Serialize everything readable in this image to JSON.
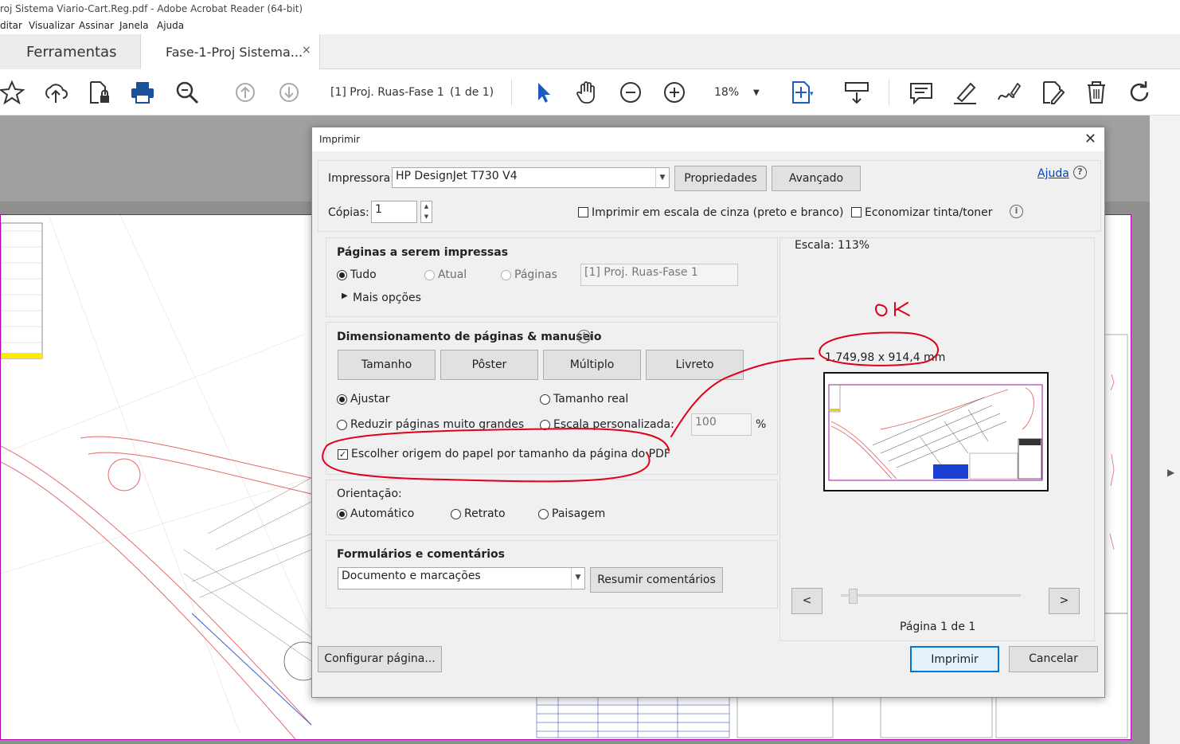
{
  "window": {
    "title": "roj Sistema Viario-Cart.Reg.pdf - Adobe Acrobat Reader (64-bit)"
  },
  "menu": [
    "ditar",
    "Visualizar",
    "Assinar",
    "Janela",
    "Ajuda"
  ],
  "tabs": {
    "tools": "Ferramentas",
    "document": "Fase-1-Proj Sistema...",
    "close": "×"
  },
  "toolbar": {
    "page_label": "[1] Proj. Ruas-Fase 1",
    "page_count": "(1 de 1)",
    "zoom": "18%",
    "icons": [
      "star-icon",
      "cloud-upload-icon",
      "file-lock-icon",
      "print-icon",
      "zoom-search-icon",
      "arrow-up-icon",
      "arrow-down-icon",
      "pointer-icon",
      "hand-icon",
      "zoom-out-icon",
      "zoom-in-icon",
      "fit-page-icon",
      "scroll-mode-icon",
      "comment-icon",
      "highlight-icon",
      "sign-icon",
      "edit-icon",
      "delete-icon",
      "rotate-icon"
    ]
  },
  "dialog": {
    "title": "Imprimir",
    "close": "✕",
    "printer_label": "Impressora:",
    "printer_value": "HP DesignJet T730 V4",
    "properties_button": "Propriedades",
    "advanced_button": "Avançado",
    "help_link": "Ajuda",
    "help_glyph": "?",
    "copies_label": "Cópias:",
    "copies_value": "1",
    "grayscale_label": "Imprimir em escala de cinza (preto e branco)",
    "save_ink_label": "Economizar tinta/toner",
    "info_glyph": "i",
    "pages_group": {
      "title": "Páginas a serem impressas",
      "all": "Tudo",
      "current": "Atual",
      "pages": "Páginas",
      "pages_field": "[1] Proj. Ruas-Fase 1",
      "more_options": "Mais opções"
    },
    "sizing_group": {
      "title": "Dimensionamento de páginas & manuseio",
      "size_button": "Tamanho",
      "poster_button": "Pôster",
      "multiple_button": "Múltiplo",
      "booklet_button": "Livreto",
      "fit": "Ajustar",
      "actual_size": "Tamanho real",
      "shrink": "Reduzir páginas muito grandes",
      "custom_scale": "Escala personalizada:",
      "custom_scale_value": "100",
      "percent": "%",
      "choose_paper": "Escolher origem do papel por tamanho da página do PDF"
    },
    "orientation_group": {
      "title": "Orientação:",
      "auto": "Automático",
      "portrait": "Retrato",
      "landscape": "Paisagem"
    },
    "forms_group": {
      "title": "Formulários e comentários",
      "select_value": "Documento e marcações",
      "summarize_button": "Resumir comentários"
    },
    "preview": {
      "scale": "Escala: 113%",
      "dimensions": "1.749,98 x 914,4 mm",
      "prev": "<",
      "next": ">",
      "page_info": "Página 1 de 1"
    },
    "page_setup_button": "Configurar página...",
    "print_button": "Imprimir",
    "cancel_button": "Cancelar"
  },
  "annotations": {
    "handwritten": "OK",
    "color": "#e0001a"
  }
}
